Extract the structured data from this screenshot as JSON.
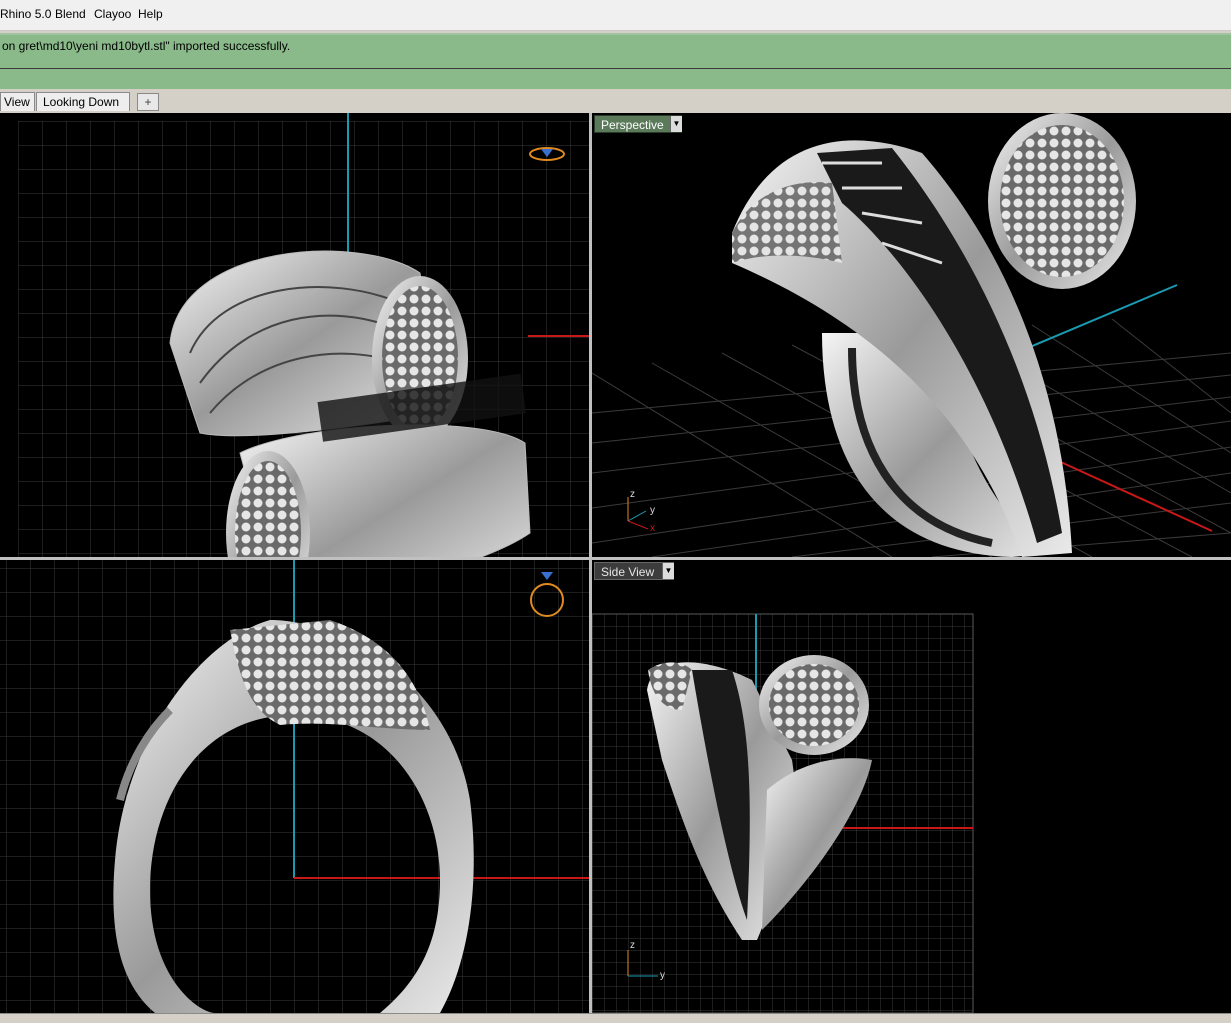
{
  "menubar": {
    "items": [
      {
        "label": "Rhino 5.0"
      },
      {
        "label": "Blend"
      },
      {
        "label": "Clayoo"
      },
      {
        "label": "Help"
      }
    ]
  },
  "command": {
    "history": "on gret\\md10\\yeni md10bytl.stl\" imported successfully.",
    "prompt": ""
  },
  "tabs": {
    "items": [
      {
        "label": "View"
      },
      {
        "label": "Looking Down"
      }
    ],
    "add_label": "+"
  },
  "viewports": {
    "perspective": {
      "label": "Perspective"
    },
    "side": {
      "label": "Side View"
    }
  },
  "axes": {
    "perspective": {
      "z": "z",
      "y": "y",
      "x": "x"
    },
    "side": {
      "z": "z",
      "y": "y"
    }
  },
  "colors": {
    "cmd_bg": "#8ab98a",
    "grid": "#3a3a3a",
    "axis_x": "#c81818",
    "axis_y": "#1a9ab0",
    "gumball": "#e08a20"
  }
}
